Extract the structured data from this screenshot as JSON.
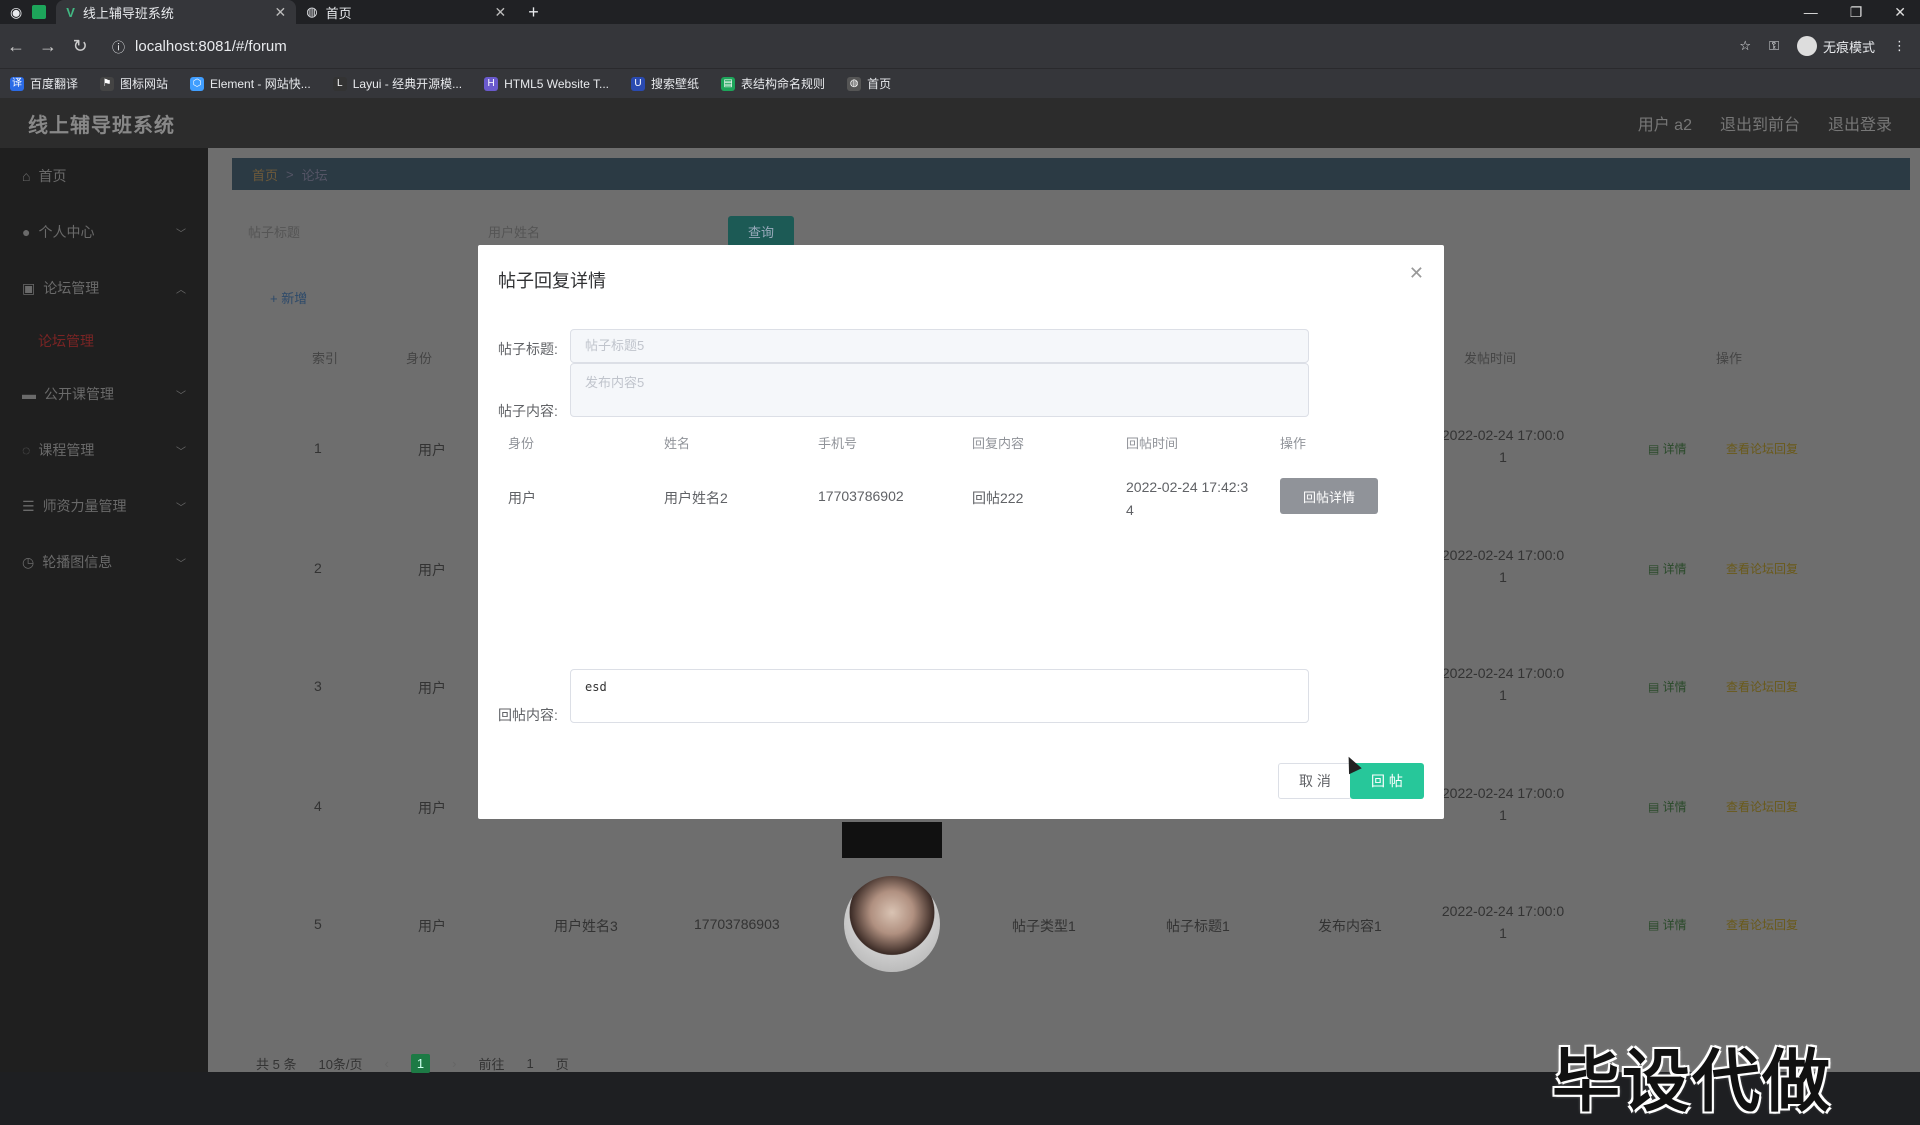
{
  "browser": {
    "tabs": [
      {
        "label": "线上辅导班系统",
        "active": true
      },
      {
        "label": "首页",
        "active": false
      }
    ],
    "url": "localhost:8081/#/forum",
    "profile_label": "无痕模式",
    "bookmarks": [
      "百度翻译",
      "图标网站",
      "Element - 网站快...",
      "Layui - 经典开源模...",
      "HTML5 Website T...",
      "搜索壁纸",
      "表结构命名规则",
      "首页"
    ]
  },
  "header": {
    "brand": "线上辅导班系统",
    "user": "用户 a2",
    "back_to_front": "退出到前台",
    "logout": "退出登录"
  },
  "sidebar": {
    "items": [
      {
        "label": "首页",
        "icon": "home-icon"
      },
      {
        "label": "个人中心",
        "icon": "user-icon"
      },
      {
        "label": "论坛管理",
        "icon": "forum-icon"
      },
      {
        "label": "公开课管理",
        "icon": "course-icon"
      },
      {
        "label": "课程管理",
        "icon": "class-icon"
      },
      {
        "label": "师资力量管理",
        "icon": "teacher-icon"
      },
      {
        "label": "轮播图信息",
        "icon": "carousel-icon"
      }
    ],
    "sub_active": "论坛管理"
  },
  "breadcrumb": {
    "home": "首页",
    "sep": ">",
    "current": "论坛"
  },
  "filters": {
    "title_placeholder": "帖子标题",
    "name_placeholder": "用户姓名",
    "query": "查询"
  },
  "add_label": "+ 新增",
  "table": {
    "headers": {
      "index": "索引",
      "identity": "身份",
      "time": "发帖时间",
      "ops": "操作"
    },
    "rows": [
      {
        "index": "1",
        "identity": "用户",
        "time1": "2022-02-24 17:00:0",
        "time2": "1"
      },
      {
        "index": "2",
        "identity": "用户",
        "time1": "2022-02-24 17:00:0",
        "time2": "1"
      },
      {
        "index": "3",
        "identity": "用户",
        "time1": "2022-02-24 17:00:0",
        "time2": "1"
      },
      {
        "index": "4",
        "identity": "用户",
        "time1": "2022-02-24 17:00:0",
        "time2": "1"
      },
      {
        "index": "5",
        "identity": "用户",
        "name": "用户姓名3",
        "phone": "17703786903",
        "type": "帖子类型1",
        "title": "帖子标题1",
        "content": "发布内容1",
        "time1": "2022-02-24 17:00:0",
        "time2": "1"
      }
    ],
    "op_detail": "详情",
    "op_reply": "查看论坛回复"
  },
  "pager": {
    "total": "共 5 条",
    "size": "10条/页",
    "page": "1",
    "goto": "前往",
    "goto_page": "1",
    "unit": "页"
  },
  "watermark": "毕设代做",
  "modal": {
    "title": "帖子回复详情",
    "title_label": "帖子标题:",
    "title_value": "帖子标题5",
    "content_label": "帖子内容:",
    "content_value": "发布内容5",
    "cols": [
      "身份",
      "姓名",
      "手机号",
      "回复内容",
      "回帖时间",
      "操作"
    ],
    "reply": {
      "identity": "用户",
      "name": "用户姓名2",
      "phone": "17703786902",
      "content": "回帖222",
      "time1": "2022-02-24 17:42:3",
      "time2": "4",
      "btn": "回帖详情"
    },
    "reply_label": "回帖内容:",
    "reply_value": "esd",
    "cancel": "取 消",
    "submit": "回 帖"
  }
}
